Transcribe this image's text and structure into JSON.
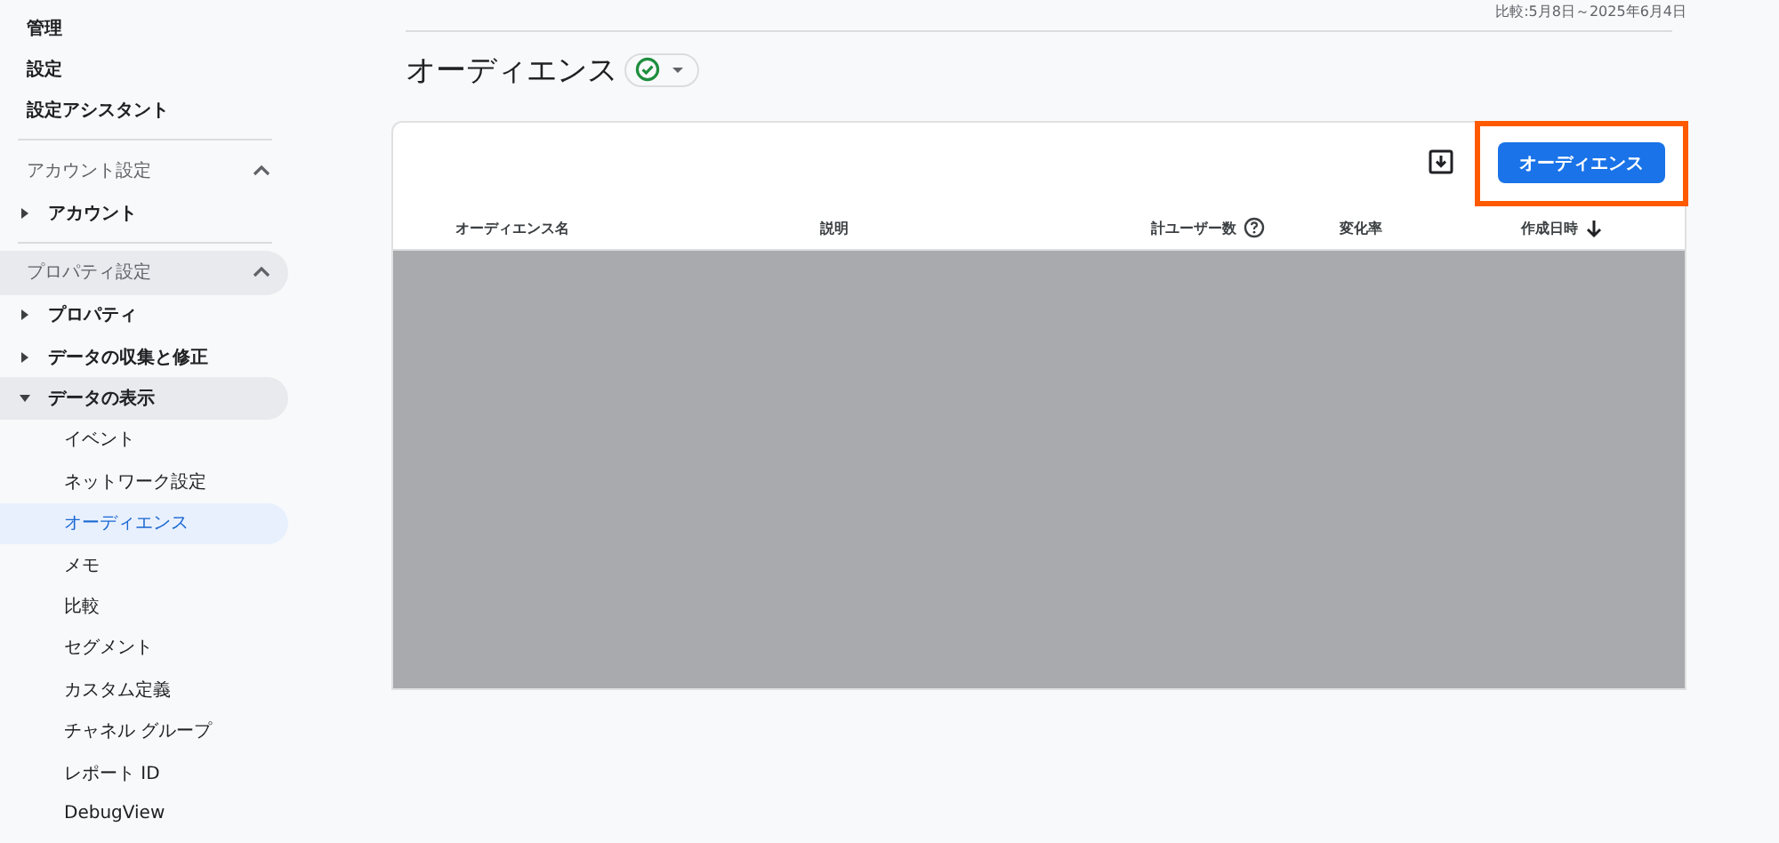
{
  "sidebar": {
    "top_items": [
      {
        "label": "管理"
      },
      {
        "label": "設定"
      },
      {
        "label": "設定アシスタント"
      }
    ],
    "sections": [
      {
        "title": "アカウント設定",
        "expanded": true,
        "highlighted": false,
        "items": [
          {
            "label": "アカウント",
            "expanded": false,
            "highlighted": false
          }
        ]
      },
      {
        "title": "プロパティ設定",
        "expanded": true,
        "highlighted": true,
        "items": [
          {
            "label": "プロパティ",
            "expanded": false,
            "highlighted": false
          },
          {
            "label": "データの収集と修正",
            "expanded": false,
            "highlighted": false
          },
          {
            "label": "データの表示",
            "expanded": true,
            "highlighted": true,
            "children": [
              {
                "label": "イベント",
                "selected": false
              },
              {
                "label": "ネットワーク設定",
                "selected": false
              },
              {
                "label": "オーディエンス",
                "selected": true
              },
              {
                "label": "メモ",
                "selected": false
              },
              {
                "label": "比較",
                "selected": false
              },
              {
                "label": "セグメント",
                "selected": false
              },
              {
                "label": "カスタム定義",
                "selected": false
              },
              {
                "label": "チャネル グループ",
                "selected": false
              },
              {
                "label": "レポート ID",
                "selected": false
              },
              {
                "label": "DebugView",
                "selected": false
              }
            ]
          }
        ]
      }
    ]
  },
  "date_range": "比較:5月8日～2025年6月4日",
  "page_title": "オーディエンス",
  "toolbar": {
    "new_button": {
      "label": "オーディエンス",
      "highlighted": true
    }
  },
  "table": {
    "columns": [
      {
        "label": "オーディエンス名",
        "kind": "text"
      },
      {
        "label": "説明",
        "kind": "text"
      },
      {
        "label": "計ユーザー数",
        "kind": "number"
      },
      {
        "label": "変化率",
        "kind": "text"
      },
      {
        "label": "作成日時",
        "kind": "sorted"
      }
    ],
    "body_masked": true
  }
}
